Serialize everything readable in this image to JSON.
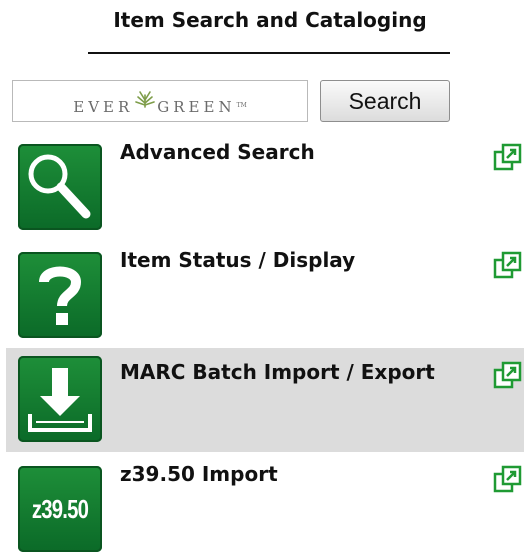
{
  "page": {
    "title": "Item Search and Cataloging"
  },
  "search": {
    "logo": {
      "before": "EVER",
      "after": "GREEN",
      "mark": "TM",
      "icon": "evergreen-leaf-icon"
    },
    "button_label": "Search"
  },
  "items": [
    {
      "label": "Advanced Search",
      "icon": "magnifier-icon",
      "popout_icon": "open-new-window-icon",
      "highlighted": false
    },
    {
      "label": "Item Status / Display",
      "icon": "question-mark-icon",
      "popout_icon": "open-new-window-icon",
      "highlighted": false
    },
    {
      "label": "MARC Batch Import / Export",
      "icon": "download-tray-icon",
      "popout_icon": "open-new-window-icon",
      "highlighted": true
    },
    {
      "label": "z39.50 Import",
      "icon": "z3950-icon",
      "icon_text": "z39.50",
      "popout_icon": "open-new-window-icon",
      "highlighted": false
    }
  ],
  "colors": {
    "tile_green": "#1e8f39",
    "popout_green": "#1f9a33",
    "highlight_bg": "#dcdcdc"
  }
}
